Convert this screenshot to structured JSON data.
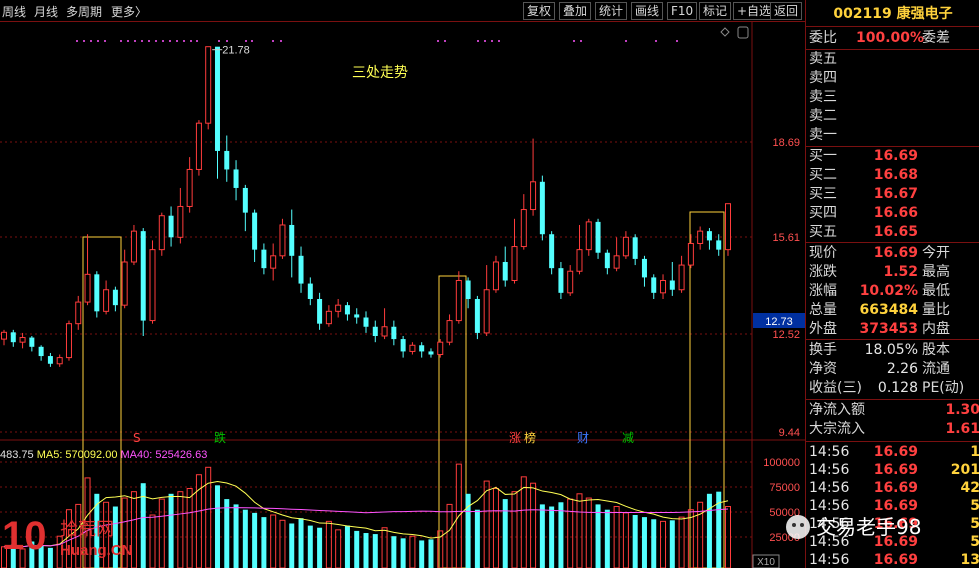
{
  "toolbar": {
    "left_items": [
      "周线",
      "月线",
      "多周期",
      "更多〉"
    ],
    "right_buttons": [
      "复权",
      "叠加",
      "统计",
      "画线",
      "F10",
      "标记",
      "+自选",
      "返回"
    ]
  },
  "chart": {
    "annotation": "三处走势",
    "high_label": "21.78",
    "y_ticks": [
      "18.69",
      "15.61",
      "12.52",
      "9.44"
    ],
    "current_price_tag": "12.73",
    "markers": [
      {
        "text": "S",
        "color": "#ff4040"
      },
      {
        "text": "跌",
        "color": "#00c000"
      },
      {
        "text": "涨",
        "color": "#ff4040"
      },
      {
        "text": "榜",
        "color": "#ffd23c"
      },
      {
        "text": "财",
        "color": "#3c78ff"
      },
      {
        "text": "减",
        "color": "#00c000"
      }
    ],
    "volume_header": {
      "vol": "483.75",
      "ma5_label": "MA5: 570092.00",
      "ma40_label": "MA40: 525426.63"
    },
    "vol_ticks": [
      "100000",
      "75000",
      "50000",
      "25000"
    ],
    "vol_unit": "X10",
    "colors": {
      "up": "#ff3c3c",
      "down": "#54ffff",
      "ma5": "#ffff54",
      "ma40": "#ff54ff",
      "box": "#ffd23c",
      "grid": "#7a1010"
    }
  },
  "candles": [
    [
      12.3,
      12.52,
      12.1,
      12.6
    ],
    [
      12.52,
      12.2,
      12.05,
      12.6
    ],
    [
      12.2,
      12.35,
      12.0,
      12.5
    ],
    [
      12.35,
      12.05,
      11.9,
      12.4
    ],
    [
      12.05,
      11.75,
      11.6,
      12.1
    ],
    [
      11.75,
      11.5,
      11.4,
      11.85
    ],
    [
      11.5,
      11.7,
      11.4,
      11.8
    ],
    [
      11.7,
      12.8,
      11.6,
      12.9
    ],
    [
      12.8,
      13.5,
      12.6,
      13.7
    ],
    [
      13.5,
      14.4,
      13.4,
      15.7
    ],
    [
      14.4,
      13.2,
      13.0,
      14.5
    ],
    [
      13.2,
      13.9,
      13.1,
      14.2
    ],
    [
      13.9,
      13.4,
      13.2,
      14.0
    ],
    [
      13.4,
      14.8,
      13.3,
      15.2
    ],
    [
      14.8,
      15.8,
      14.7,
      16.0
    ],
    [
      15.8,
      12.9,
      12.4,
      15.9
    ],
    [
      12.9,
      15.2,
      12.8,
      15.5
    ],
    [
      15.2,
      16.3,
      15.0,
      16.4
    ],
    [
      16.3,
      15.6,
      15.3,
      16.6
    ],
    [
      15.6,
      16.6,
      15.4,
      17.2
    ],
    [
      16.6,
      17.8,
      16.4,
      18.2
    ],
    [
      17.8,
      19.3,
      17.6,
      19.4
    ],
    [
      19.3,
      21.78,
      19.1,
      21.78
    ],
    [
      21.78,
      18.4,
      17.5,
      21.5
    ],
    [
      18.4,
      17.8,
      17.4,
      18.9
    ],
    [
      17.8,
      17.2,
      16.8,
      18.1
    ],
    [
      17.2,
      16.4,
      15.8,
      17.3
    ],
    [
      16.4,
      15.2,
      14.8,
      16.5
    ],
    [
      15.2,
      14.6,
      14.4,
      15.4
    ],
    [
      14.6,
      15.0,
      14.2,
      15.4
    ],
    [
      15.0,
      16.0,
      14.9,
      16.2
    ],
    [
      16.0,
      15.0,
      14.3,
      16.5
    ],
    [
      15.0,
      14.1,
      13.8,
      15.3
    ],
    [
      14.1,
      13.6,
      13.4,
      14.3
    ],
    [
      13.6,
      12.8,
      12.6,
      13.8
    ],
    [
      12.8,
      13.2,
      12.7,
      13.4
    ],
    [
      13.2,
      13.4,
      13.0,
      13.6
    ],
    [
      13.4,
      13.1,
      12.9,
      13.5
    ],
    [
      13.1,
      13.0,
      12.8,
      13.3
    ],
    [
      13.0,
      12.7,
      12.5,
      13.2
    ],
    [
      12.7,
      12.4,
      12.2,
      12.9
    ],
    [
      12.4,
      12.7,
      12.3,
      13.3
    ],
    [
      12.7,
      12.3,
      12.1,
      12.9
    ],
    [
      12.3,
      11.9,
      11.7,
      12.4
    ],
    [
      11.9,
      12.1,
      11.8,
      12.2
    ],
    [
      12.1,
      11.9,
      11.7,
      12.2
    ],
    [
      11.9,
      11.8,
      11.7,
      12.0
    ],
    [
      11.8,
      12.2,
      11.7,
      12.3
    ],
    [
      12.2,
      12.9,
      12.1,
      13.1
    ],
    [
      12.9,
      14.2,
      12.8,
      14.5
    ],
    [
      14.2,
      13.6,
      13.3,
      14.3
    ],
    [
      13.6,
      12.5,
      12.3,
      13.7
    ],
    [
      12.5,
      13.9,
      12.4,
      14.7
    ],
    [
      13.9,
      14.8,
      13.8,
      15.0
    ],
    [
      14.8,
      14.2,
      14.0,
      15.3
    ],
    [
      14.2,
      15.3,
      14.1,
      16.2
    ],
    [
      15.3,
      16.5,
      15.2,
      17.0
    ],
    [
      16.5,
      17.4,
      16.3,
      18.8
    ],
    [
      17.4,
      15.7,
      15.5,
      17.6
    ],
    [
      15.7,
      14.6,
      14.4,
      15.8
    ],
    [
      14.6,
      13.8,
      13.6,
      14.8
    ],
    [
      13.8,
      14.5,
      13.7,
      14.7
    ],
    [
      14.5,
      15.2,
      14.4,
      16.0
    ],
    [
      15.2,
      16.1,
      15.0,
      16.2
    ],
    [
      16.1,
      15.1,
      14.9,
      16.2
    ],
    [
      15.1,
      14.6,
      14.4,
      15.2
    ],
    [
      14.6,
      15.0,
      14.5,
      15.6
    ],
    [
      15.0,
      15.6,
      14.9,
      15.8
    ],
    [
      15.6,
      14.9,
      14.7,
      15.7
    ],
    [
      14.9,
      14.3,
      14.0,
      15.0
    ],
    [
      14.3,
      13.8,
      13.6,
      14.4
    ],
    [
      13.8,
      14.2,
      13.6,
      14.4
    ],
    [
      14.2,
      13.9,
      13.7,
      14.8
    ],
    [
      13.9,
      14.7,
      13.8,
      15.0
    ],
    [
      14.7,
      15.4,
      14.6,
      15.7
    ],
    [
      15.4,
      15.8,
      15.2,
      15.95
    ],
    [
      15.8,
      15.5,
      15.2,
      15.9
    ],
    [
      15.5,
      15.2,
      15.0,
      15.7
    ],
    [
      15.2,
      16.69,
      15.0,
      16.69
    ]
  ],
  "volumes": [
    20,
    22,
    18,
    25,
    21,
    19,
    30,
    55,
    60,
    85,
    70,
    62,
    58,
    66,
    72,
    80,
    50,
    65,
    70,
    72,
    75,
    88,
    95,
    78,
    65,
    60,
    55,
    52,
    48,
    50,
    45,
    42,
    47,
    40,
    38,
    44,
    36,
    40,
    35,
    33,
    32,
    38,
    30,
    28,
    30,
    26,
    27,
    35,
    60,
    98,
    70,
    55,
    82,
    75,
    65,
    72,
    86,
    80,
    60,
    58,
    62,
    65,
    70,
    66,
    60,
    55,
    58,
    52,
    50,
    48,
    46,
    44,
    45,
    48,
    55,
    62,
    70,
    72,
    58,
    66
  ],
  "panel": {
    "code": "002119",
    "name": "康强电子",
    "weibi_label": "委比",
    "weibi_value": "100.00%",
    "weicha_label": "委差",
    "sell_labels": [
      "卖五",
      "卖四",
      "卖三",
      "卖二",
      "卖一"
    ],
    "buy": [
      {
        "label": "买一",
        "price": "16.69"
      },
      {
        "label": "买二",
        "price": "16.68"
      },
      {
        "label": "买三",
        "price": "16.67"
      },
      {
        "label": "买四",
        "price": "16.66"
      },
      {
        "label": "买五",
        "price": "16.65"
      }
    ],
    "quote": [
      {
        "l": "现价",
        "v": "16.69",
        "vc": "red",
        "r": "今开"
      },
      {
        "l": "涨跌",
        "v": "1.52",
        "vc": "red",
        "r": "最高"
      },
      {
        "l": "涨幅",
        "v": "10.02%",
        "vc": "red",
        "r": "最低"
      },
      {
        "l": "总量",
        "v": "663484",
        "vc": "yellow",
        "r": "量比"
      },
      {
        "l": "外盘",
        "v": "373453",
        "vc": "red",
        "r": "内盘"
      }
    ],
    "stats": [
      {
        "l": "换手",
        "v": "18.05%",
        "r": "股本"
      },
      {
        "l": "净资",
        "v": "2.26",
        "r": "流通"
      },
      {
        "l": "收益(三)",
        "v": "0.128",
        "r": "PE(动)"
      }
    ],
    "flow": [
      {
        "l": "净流入额",
        "v": "1.30"
      },
      {
        "l": "大宗流入",
        "v": "1.61"
      }
    ],
    "ticks": [
      {
        "t": "14:56",
        "p": "16.69",
        "v": "1"
      },
      {
        "t": "14:56",
        "p": "16.69",
        "v": "201"
      },
      {
        "t": "14:56",
        "p": "16.69",
        "v": "42"
      },
      {
        "t": "14:56",
        "p": "16.69",
        "v": "5"
      },
      {
        "t": "14:56",
        "p": "16.69",
        "v": "5"
      },
      {
        "t": "14:56",
        "p": "16.69",
        "v": "5"
      },
      {
        "t": "14:56",
        "p": "16.69",
        "v": "13"
      }
    ]
  },
  "watermark": {
    "left_num": "10",
    "left_cn": "拾荒网",
    "left_url": "Huang.CN",
    "right_text": "交易老手98"
  }
}
